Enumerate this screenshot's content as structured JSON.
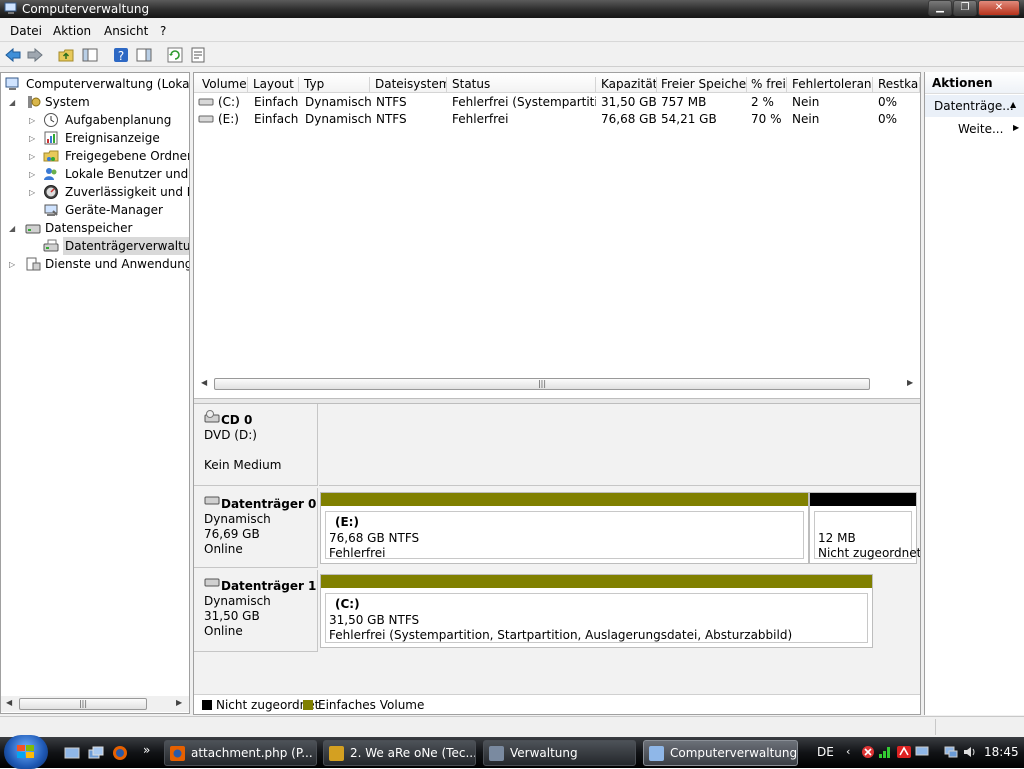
{
  "window": {
    "title": "Computerverwaltung"
  },
  "menu": [
    "Datei",
    "Aktion",
    "Ansicht",
    "?"
  ],
  "tree": {
    "root": "Computerverwaltung (Lokal)",
    "system": "System",
    "system_items": [
      "Aufgabenplanung",
      "Ereignisanzeige",
      "Freigegebene Ordner",
      "Lokale Benutzer und Gruppen",
      "Zuverlässigkeit und Leistung",
      "Geräte-Manager"
    ],
    "storage": "Datenspeicher",
    "storage_items": [
      "Datenträgerverwaltung"
    ],
    "services": "Dienste und Anwendungen"
  },
  "volume_list": {
    "columns": [
      "Volume",
      "Layout",
      "Typ",
      "Dateisystem",
      "Status",
      "Kapazität",
      "Freier Speicher",
      "% frei",
      "Fehlertoleranz",
      "Restkap"
    ],
    "rows": [
      [
        "(C:)",
        "Einfach",
        "Dynamisch",
        "NTFS",
        "Fehlerfrei (Systempartiti...",
        "31,50 GB",
        "757 MB",
        "2 %",
        "Nein",
        "0%"
      ],
      [
        "(E:)",
        "Einfach",
        "Dynamisch",
        "NTFS",
        "Fehlerfrei",
        "76,68 GB",
        "54,21 GB",
        "70 %",
        "Nein",
        "0%"
      ]
    ]
  },
  "disks": [
    {
      "name": "CD 0",
      "lines": [
        "DVD (D:)",
        "",
        "Kein Medium"
      ]
    },
    {
      "name": "Datenträger 0",
      "lines": [
        "Dynamisch",
        "76,69 GB",
        "Online"
      ],
      "partitions": [
        {
          "label": "(E:)",
          "size": "76,68 GB NTFS",
          "status": "Fehlerfrei",
          "kind": "simple"
        },
        {
          "label": "",
          "size": "12 MB",
          "status": "Nicht zugeordnet",
          "kind": "unallocated"
        }
      ]
    },
    {
      "name": "Datenträger 1",
      "lines": [
        "Dynamisch",
        "31,50 GB",
        "Online"
      ],
      "partitions": [
        {
          "label": "(C:)",
          "size": "31,50 GB NTFS",
          "status": "Fehlerfrei (Systempartition, Startpartition, Auslagerungsdatei, Absturzabbild)",
          "kind": "simple"
        }
      ]
    }
  ],
  "legend": [
    "Nicht zugeordnet",
    "Einfaches Volume"
  ],
  "actions": {
    "title": "Aktionen",
    "items": [
      "Datenträge...",
      "Weite..."
    ]
  },
  "taskbar": {
    "tasks": [
      "attachment.php (P...",
      "2. We aRe oNe (Tec...",
      "Verwaltung",
      "Computerverwaltung"
    ],
    "lang": "DE",
    "clock": "18:45"
  },
  "colors": {
    "simple": "#808000",
    "unallocated": "#000000"
  }
}
